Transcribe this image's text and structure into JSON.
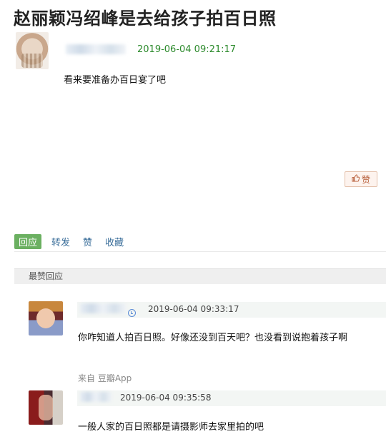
{
  "post": {
    "title": "赵丽颖冯绍峰是去给孩子拍百日照",
    "timestamp": "2019-06-04 09:21:17",
    "content": "看来要准备办百日宴了吧",
    "like_label": "赞"
  },
  "actions": {
    "reply": "回应",
    "forward": "转发",
    "like": "赞",
    "collect": "收藏"
  },
  "best_replies": {
    "header": "最赞回应",
    "items": [
      {
        "timestamp": "2019-06-04 09:33:17",
        "text": "你咋知道人拍百日照。好像还没到百天吧？也没看到说抱着孩子啊",
        "source": "来自 豆瓣App"
      },
      {
        "timestamp": "2019-06-04 09:35:58",
        "text": "一般人家的百日照都是请摄影师去家里拍的吧"
      }
    ]
  },
  "colors": {
    "timestamp_green": "#2c8a2c",
    "reply_button": "#6bb061",
    "link_blue": "#3a6e9a",
    "like_button_border": "#e3bfa9"
  }
}
